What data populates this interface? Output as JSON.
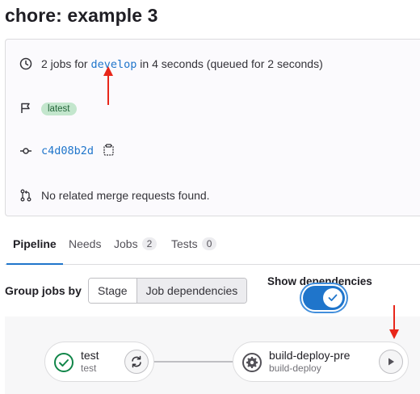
{
  "page": {
    "title": "chore: example 3"
  },
  "info": {
    "jobs_prefix": "2 jobs for",
    "branch": "develop",
    "jobs_suffix": "in 4 seconds (queued for 2 seconds)",
    "tag": "latest",
    "commit_sha": "c4d08b2d",
    "merge_requests": "No related merge requests found."
  },
  "tabs": [
    {
      "label": "Pipeline",
      "active": true
    },
    {
      "label": "Needs"
    },
    {
      "label": "Jobs",
      "count": "2"
    },
    {
      "label": "Tests",
      "count": "0"
    }
  ],
  "controls": {
    "group_by_label": "Group jobs by",
    "stage_option": "Stage",
    "job_deps_option": "Job dependencies",
    "show_deps_label": "Show dependencies",
    "show_deps_on": true
  },
  "jobs": [
    {
      "name": "test",
      "stage": "test",
      "status": "success",
      "action": "retry"
    },
    {
      "name": "build-deploy-pre",
      "stage": "build-deploy",
      "status": "manual",
      "action": "play"
    }
  ],
  "colors": {
    "accent": "#1f75cb",
    "success": "#108548",
    "annotation": "#e8261a"
  }
}
